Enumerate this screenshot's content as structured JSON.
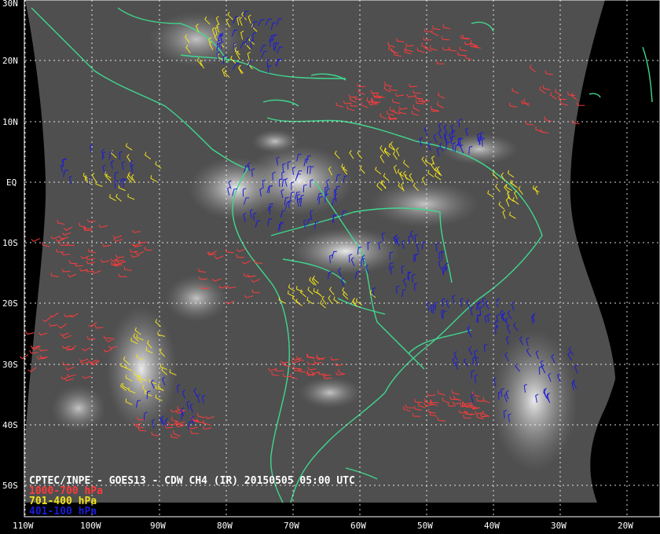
{
  "map": {
    "title": "CPTEC/INPE - GOES13 - CDW CH4 (IR) 20150505 05:00 UTC",
    "legend": [
      {
        "label": "1000-700 hPa",
        "color": "#ff3b3b"
      },
      {
        "label": "701-400 hPa",
        "color": "#f2e21b"
      },
      {
        "label": "401-100 hPa",
        "color": "#1b1bd9"
      }
    ],
    "lat_labels": [
      "30N",
      "20N",
      "10N",
      "EQ",
      "10S",
      "20S",
      "30S",
      "40S",
      "50S"
    ],
    "lon_labels": [
      "110W",
      "100W",
      "90W",
      "80W",
      "70W",
      "60W",
      "50W",
      "40W",
      "30W",
      "20W"
    ],
    "colors": {
      "background": "#000000",
      "coastline": "#3fd88f",
      "grid": "#ffffff",
      "text": "#ffffff",
      "low_level": "#ff3b3b",
      "mid_level": "#f2e21b",
      "high_level": "#1b1bd9"
    }
  }
}
